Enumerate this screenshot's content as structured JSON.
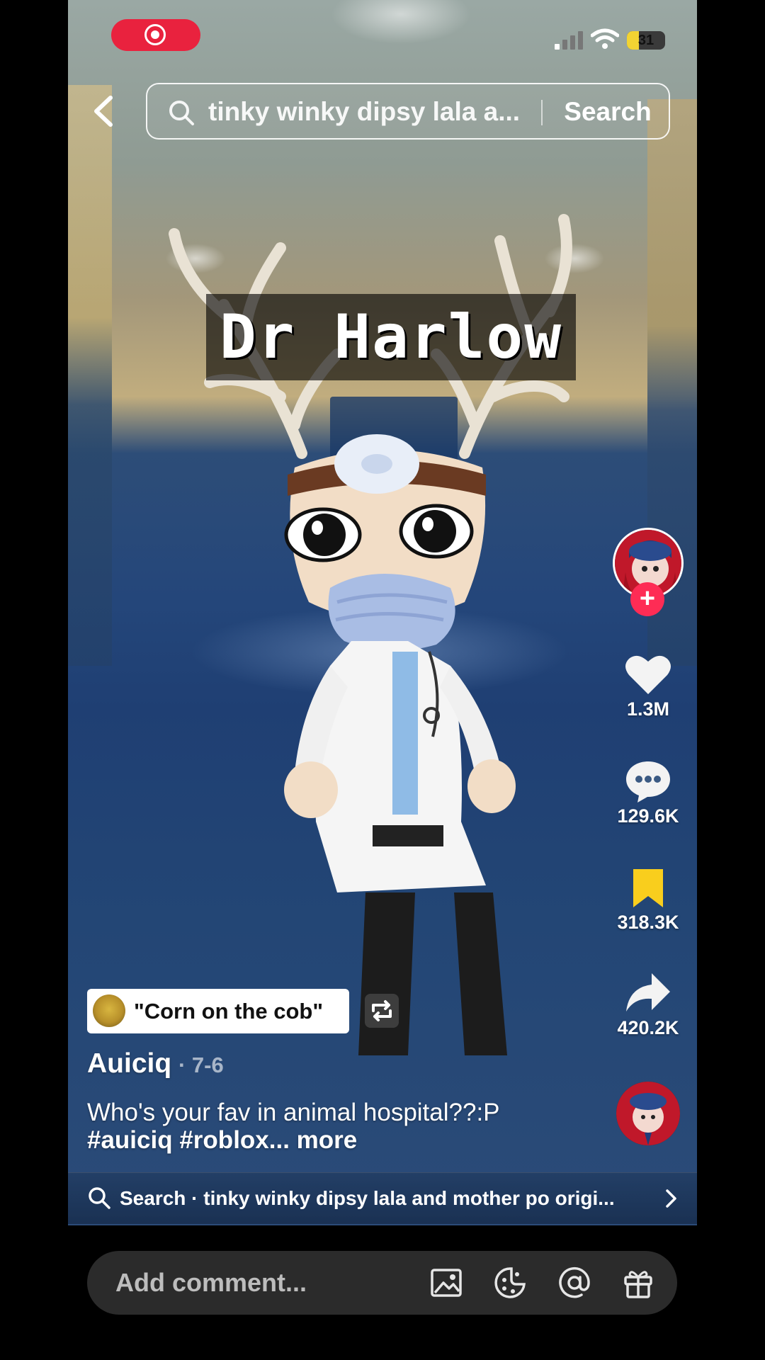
{
  "status_bar": {
    "battery_level": "31",
    "battery_fill_percent": 31,
    "recording_indicator": "record-icon"
  },
  "top_search": {
    "query": "tinky winky dipsy lala a...",
    "button_label": "Search"
  },
  "video": {
    "overlay_title": "Dr Harlow"
  },
  "right_rail": {
    "like_count": "1.3M",
    "comment_count": "129.6K",
    "save_count": "318.3K",
    "share_count": "420.2K",
    "follow_symbol": "+"
  },
  "caption": {
    "sound_label": "\"Corn on the cob\"",
    "author": "Auiciq",
    "date": "· 7-6",
    "description_text": "Who's your fav in animal hospital??:P ",
    "tag_1": "#auiciq",
    "tag_2": "#roblox",
    "more_label": "... more"
  },
  "related_search": {
    "text": "Search · tinky winky dipsy lala and mother po origi..."
  },
  "comment_bar": {
    "placeholder": "Add comment..."
  },
  "colors": {
    "accent_red": "#fe2c55",
    "record_red": "#e9223e",
    "save_yellow": "#f9ce1d",
    "battery_yellow": "#f2d333",
    "comment_bar_bg": "#2b2b2b"
  }
}
